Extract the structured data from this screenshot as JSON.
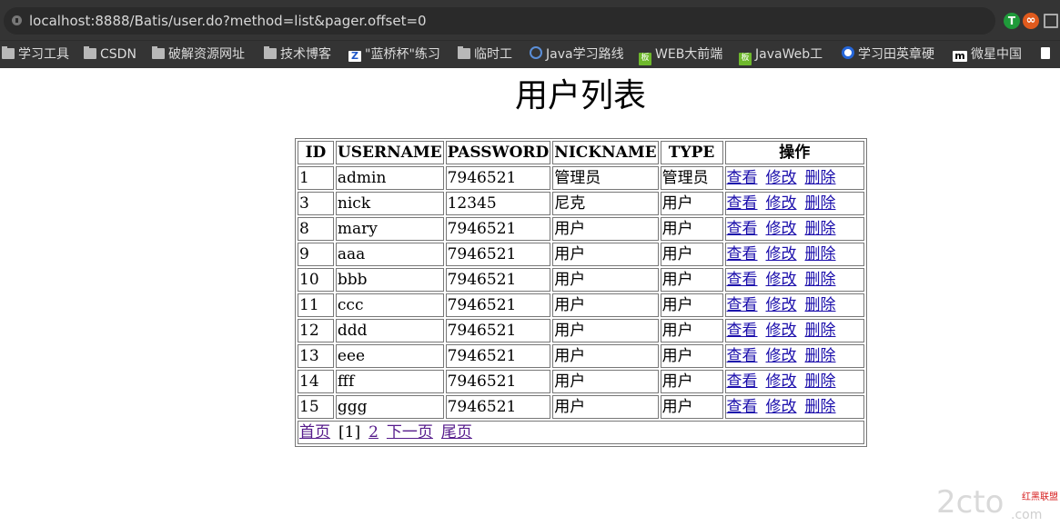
{
  "browser": {
    "url": "localhost:8888/Batis/user.do?method=list&pager.offset=0",
    "extensions": [
      "T",
      "∞"
    ],
    "bookmarks": [
      {
        "label": "学习工具",
        "icon": "folder-icon"
      },
      {
        "label": "CSDN",
        "icon": "folder-icon"
      },
      {
        "label": "破解资源网址",
        "icon": "folder-icon"
      },
      {
        "label": "技术博客",
        "icon": "folder-icon"
      },
      {
        "label": "\"蓝桥杯\"练习",
        "icon": "lanqiao-icon"
      },
      {
        "label": "临时工",
        "icon": "folder-icon"
      },
      {
        "label": "Java学习路线",
        "icon": "java-icon"
      },
      {
        "label": "WEB大前端",
        "icon": "site-icon"
      },
      {
        "label": "JavaWeb工",
        "icon": "site-icon"
      },
      {
        "label": "学习田英章硬",
        "icon": "circle-icon"
      },
      {
        "label": "微星中国",
        "icon": "msi-icon"
      }
    ]
  },
  "page": {
    "title": "用户列表"
  },
  "table": {
    "headers": [
      "ID",
      "USERNAME",
      "PASSWORD",
      "NICKNAME",
      "TYPE",
      "操作"
    ],
    "rows": [
      [
        "1",
        "admin",
        "7946521",
        "管理员",
        "管理员"
      ],
      [
        "3",
        "nick",
        "12345",
        "尼克",
        "用户"
      ],
      [
        "8",
        "mary",
        "7946521",
        "用户",
        "用户"
      ],
      [
        "9",
        "aaa",
        "7946521",
        "用户",
        "用户"
      ],
      [
        "10",
        "bbb",
        "7946521",
        "用户",
        "用户"
      ],
      [
        "11",
        "ccc",
        "7946521",
        "用户",
        "用户"
      ],
      [
        "12",
        "ddd",
        "7946521",
        "用户",
        "用户"
      ],
      [
        "13",
        "eee",
        "7946521",
        "用户",
        "用户"
      ],
      [
        "14",
        "fff",
        "7946521",
        "用户",
        "用户"
      ],
      [
        "15",
        "ggg",
        "7946521",
        "用户",
        "用户"
      ]
    ],
    "actions": {
      "view": "查看",
      "edit": "修改",
      "delete": "删除"
    }
  },
  "pager": {
    "first": "首页",
    "current": "[1]",
    "page2": "2",
    "next": "下一页",
    "last": "尾页"
  },
  "watermark": {
    "brand": "2cto",
    "domain": ".com",
    "tagline": "红黑联盟"
  },
  "colors": {
    "chrome_bg": "#343434",
    "link": "#1a0dab",
    "visited_link": "#551a8b",
    "watermark_red": "#d61d1d"
  }
}
